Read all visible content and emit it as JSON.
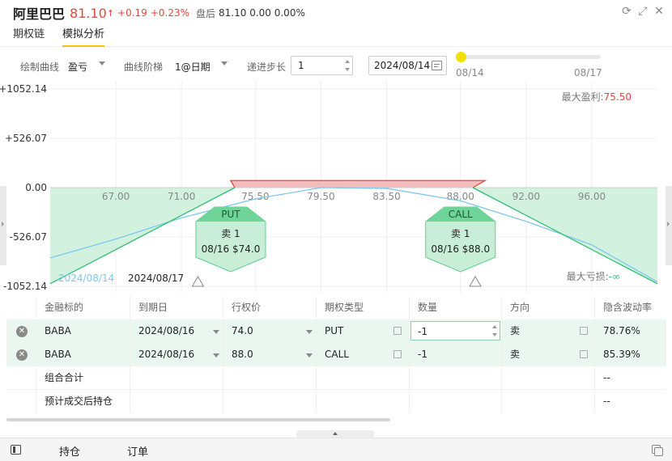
{
  "header": {
    "name": "阿里巴巴",
    "price": "81.10",
    "arrow": "↑",
    "change": "+0.19",
    "change_pct": "+0.23%",
    "after_label": "盘后",
    "after_value": "81.10 0.00 0.00%"
  },
  "window_icons": [
    "refresh-icon",
    "fullscreen-icon",
    "close-icon"
  ],
  "tabs": [
    {
      "label": "期权链",
      "active": false
    },
    {
      "label": "模拟分析",
      "active": true
    }
  ],
  "controls": {
    "curve_label": "绘制曲线",
    "curve_value": "盈亏",
    "ladder_label": "曲线阶梯",
    "ladder_value": "1@日期",
    "step_label": "递进步长",
    "step_value": "1",
    "date_value": "2024/08/14",
    "slider_start": "08/14",
    "slider_end": "08/17",
    "slider_position": 0
  },
  "chart_data": {
    "type": "line",
    "x_ticks": [
      "67.00",
      "71.00",
      "75.50",
      "79.50",
      "83.50",
      "88.00",
      "92.00",
      "96.00"
    ],
    "y_ticks": [
      "+1052.14",
      "+526.07",
      "0.00",
      "-526.07",
      "-1052.14"
    ],
    "ylim": [
      -1052.14,
      1052.14
    ],
    "xlim": [
      63.0,
      100.0
    ],
    "max_profit_label": "最大盈利:",
    "max_profit_value": "75.50",
    "max_loss_label": "最大亏损:",
    "max_loss_value": "-∞",
    "series": [
      {
        "name": "2024/08/14",
        "color": "#7dc8ec",
        "x": [
          63,
          67,
          71,
          75.5,
          79.5,
          83.5,
          88,
          92,
          96,
          100
        ],
        "y": [
          -749,
          -549,
          -322,
          -120,
          0,
          -8,
          -140,
          -360,
          -610,
          -1005
        ]
      },
      {
        "name": "2024/08/17",
        "color": "#2fbf71",
        "x": [
          63,
          74,
          75.5,
          88,
          89.5,
          100
        ],
        "y": [
          -1025,
          75.5,
          75.5,
          75.5,
          75.5,
          -1025
        ]
      }
    ],
    "legend": [
      "2024/08/14",
      "2024/08/17"
    ],
    "legend_placement": "bottom-left",
    "grid": true,
    "breakeven": [
      74.245,
      88.755
    ],
    "legs": [
      {
        "type": "PUT",
        "action": "卖 1",
        "detail": "08/16 $74.0",
        "strike": 74.0
      },
      {
        "type": "CALL",
        "action": "卖 1",
        "detail": "08/16 $88.0",
        "strike": 88.0
      }
    ],
    "colors": {
      "profit": "#f5bcbc",
      "profit_line": "#e8453c",
      "loss": "#d2f1df",
      "loss_line": "#2fbf71"
    }
  },
  "table": {
    "headers": [
      "金融标的",
      "到期日",
      "行权价",
      "期权类型",
      "数量",
      "方向",
      "隐含波动率"
    ],
    "rows": [
      {
        "symbol": "BABA",
        "expiry": "2024/08/16",
        "strike": "74.0",
        "type": "PUT",
        "qty": "-1",
        "dir": "卖",
        "iv": "78.76%"
      },
      {
        "symbol": "BABA",
        "expiry": "2024/08/16",
        "strike": "88.0",
        "type": "CALL",
        "qty": "-1",
        "dir": "卖",
        "iv": "85.39%"
      }
    ],
    "summary": [
      {
        "label": "组合合计",
        "iv": "--"
      },
      {
        "label": "预计成交后持仓",
        "iv": "--"
      }
    ]
  },
  "footer": {
    "holdings": "持仓",
    "orders": "订单"
  }
}
